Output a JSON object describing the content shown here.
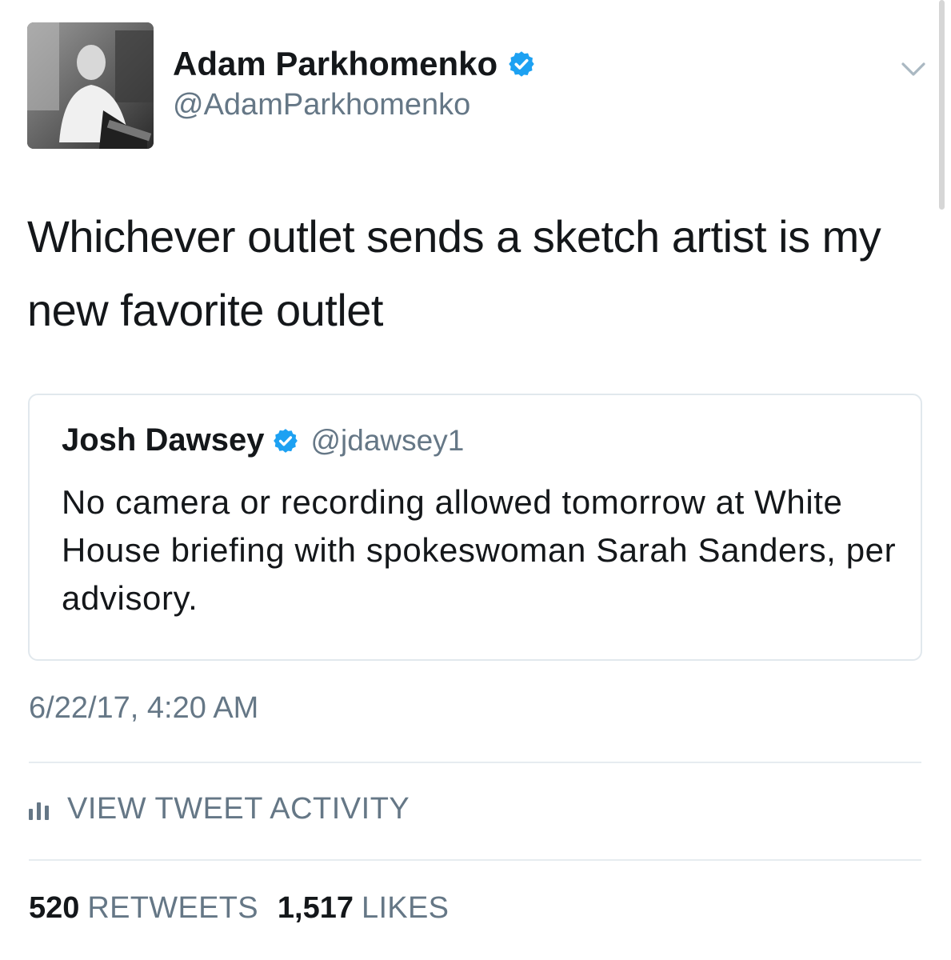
{
  "author": {
    "display_name": "Adam Parkhomenko",
    "handle": "@AdamParkhomenko",
    "verified": true
  },
  "tweet": {
    "text": "Whichever outlet sends a sketch artist is my new favorite outlet",
    "timestamp": "6/22/17, 4:20 AM"
  },
  "quoted_tweet": {
    "display_name": "Josh Dawsey",
    "handle": "@jdawsey1",
    "verified": true,
    "text": "No camera or recording allowed tomorrow at White House briefing with spokeswoman Sarah Sanders, per advisory."
  },
  "activity": {
    "label": "VIEW TWEET ACTIVITY"
  },
  "stats": {
    "retweets_count": "520",
    "retweets_label": "RETWEETS",
    "likes_count": "1,517",
    "likes_label": "LIKES"
  },
  "icons": {
    "verified": "verified-badge-icon",
    "caret": "chevron-down-icon",
    "activity": "bar-chart-icon"
  },
  "colors": {
    "verified_blue": "#1da1f2",
    "secondary_text": "#657786",
    "primary_text": "#14171a",
    "border": "#e1e8ed"
  }
}
